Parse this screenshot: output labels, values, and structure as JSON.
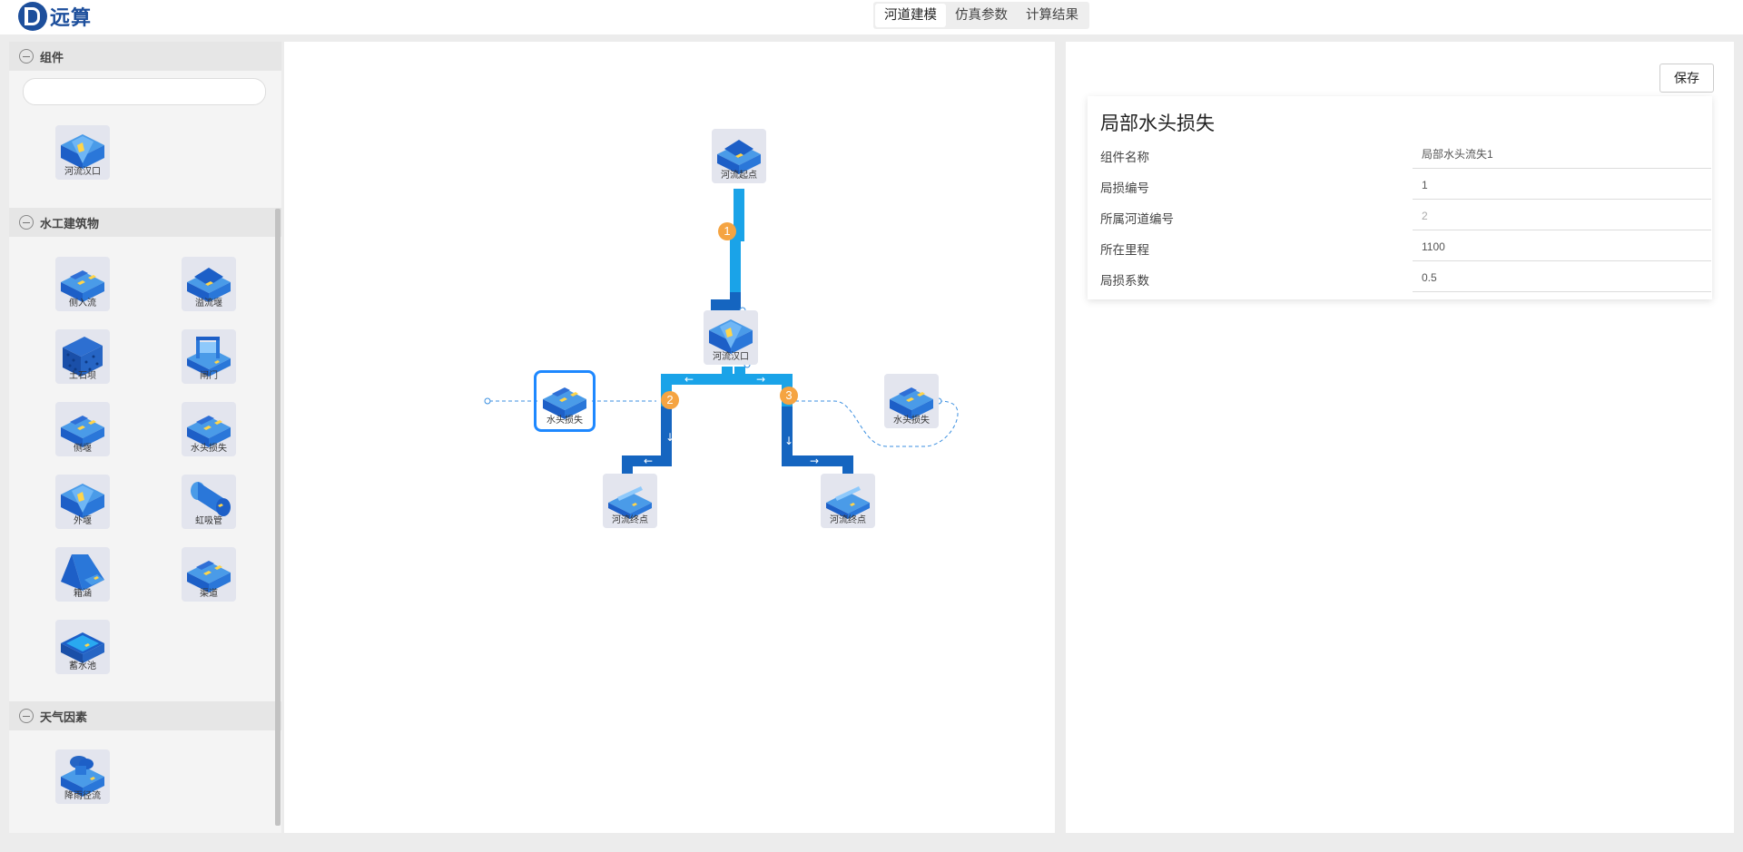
{
  "app": {
    "logo_text": "远算"
  },
  "tabs": [
    {
      "label": "河道建模",
      "active": true
    },
    {
      "label": "仿真参数",
      "active": false
    },
    {
      "label": "计算结果",
      "active": false
    }
  ],
  "sidebar": {
    "sections": [
      {
        "title": "组件",
        "items": [
          {
            "label": "河流汉口"
          }
        ]
      },
      {
        "title": "水工建筑物",
        "items": [
          {
            "label": "侧入流"
          },
          {
            "label": "溢流堰"
          },
          {
            "label": "土石坝"
          },
          {
            "label": "闸门"
          },
          {
            "label": "侧堰"
          },
          {
            "label": "水头损失"
          },
          {
            "label": "外堰"
          },
          {
            "label": "虹吸管"
          },
          {
            "label": "箱涵"
          },
          {
            "label": "渠道"
          },
          {
            "label": "蓄水池"
          }
        ]
      },
      {
        "title": "天气因素",
        "items": [
          {
            "label": "降雨径流"
          }
        ]
      }
    ],
    "search": {
      "placeholder": "",
      "value": ""
    }
  },
  "canvas": {
    "nodes": [
      {
        "label": "河流起点"
      },
      {
        "label": "河流汉口"
      },
      {
        "label": "水头损失"
      },
      {
        "label": "水头损失"
      },
      {
        "label": "河流终点"
      },
      {
        "label": "河流终点"
      }
    ],
    "badges": [
      "1",
      "2",
      "3"
    ],
    "colors": {
      "pipe_light": "#1aa3e8",
      "pipe_dark": "#1565c0",
      "badge": "#f5a442",
      "selection": "#1e88ff"
    }
  },
  "panel": {
    "save_label": "保存",
    "title": "局部水头损失",
    "fields": [
      {
        "label": "组件名称",
        "value": "局部水头流失1",
        "disabled": false
      },
      {
        "label": "局损编号",
        "value": "1",
        "disabled": false
      },
      {
        "label": "所属河道编号",
        "value": "2",
        "disabled": true
      },
      {
        "label": "所在里程",
        "value": "1100",
        "disabled": false
      },
      {
        "label": "局损系数",
        "value": "0.5",
        "disabled": false
      }
    ]
  }
}
